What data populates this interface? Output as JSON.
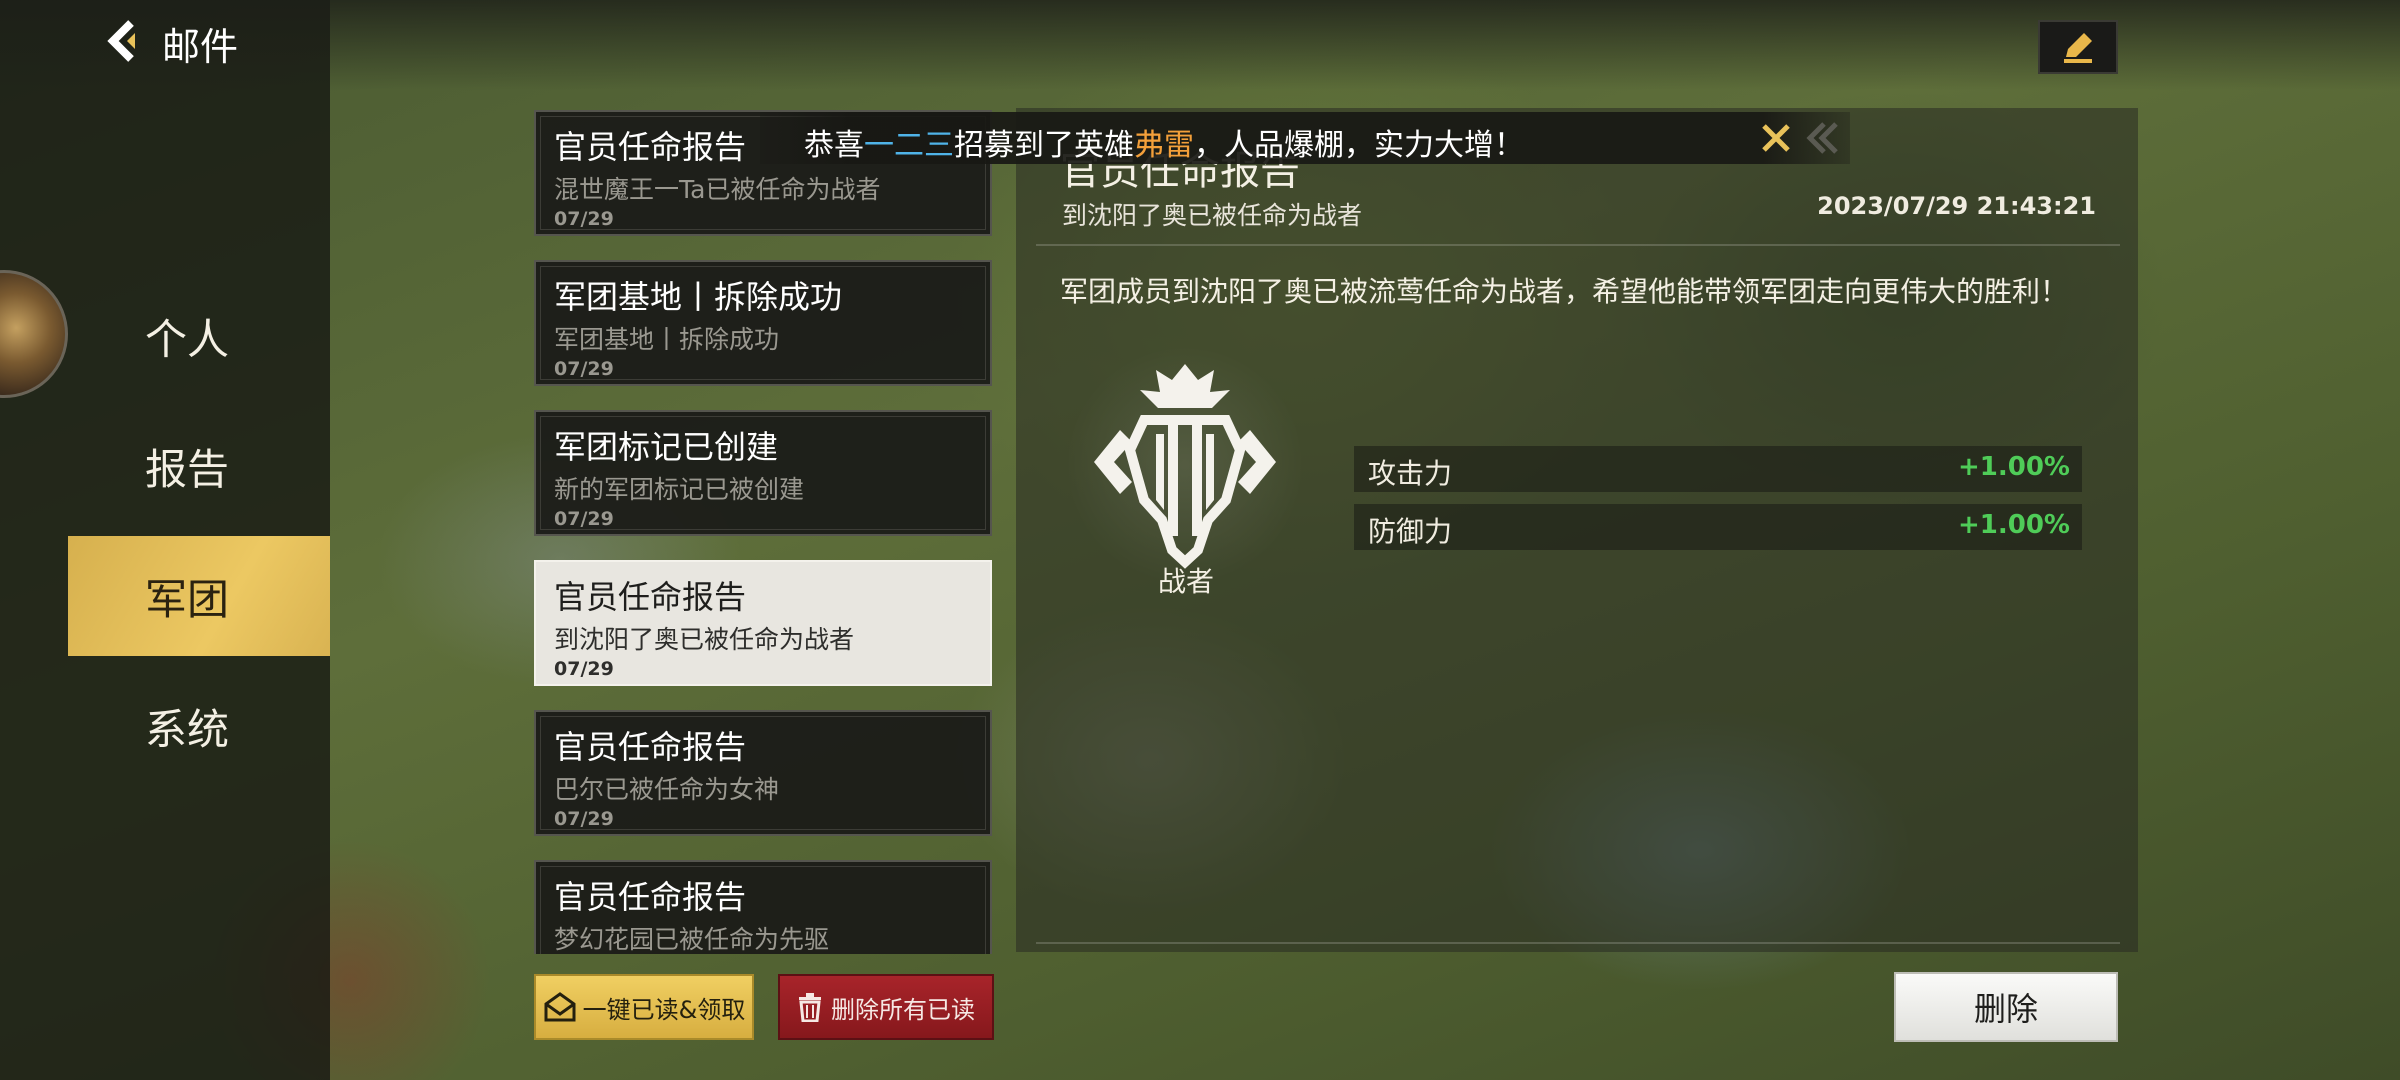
{
  "header": {
    "title": "邮件"
  },
  "sidebar": {
    "items": [
      {
        "label": "个人",
        "active": false
      },
      {
        "label": "报告",
        "active": false
      },
      {
        "label": "军团",
        "active": true
      },
      {
        "label": "系统",
        "active": false
      }
    ]
  },
  "mail_list": [
    {
      "title": "官员任命报告",
      "subtitle": "混世魔王一Ta已被任命为战者",
      "date": "07/29",
      "selected": false
    },
    {
      "title": "军团基地丨拆除成功",
      "subtitle": "军团基地丨拆除成功",
      "date": "07/29",
      "selected": false
    },
    {
      "title": "军团标记已创建",
      "subtitle": "新的军团标记已被创建",
      "date": "07/29",
      "selected": false
    },
    {
      "title": "官员任命报告",
      "subtitle": "到沈阳了奥已被任命为战者",
      "date": "07/29",
      "selected": true
    },
    {
      "title": "官员任命报告",
      "subtitle": "巴尔已被任命为女神",
      "date": "07/29",
      "selected": false
    },
    {
      "title": "官员任命报告",
      "subtitle": "梦幻花园已被任命为先驱",
      "date": "",
      "selected": false
    }
  ],
  "detail": {
    "title": "官员任命报告",
    "subtitle": "到沈阳了奥已被任命为战者",
    "timestamp": "2023/07/29 21:43:21",
    "body": "军团成员到沈阳了奥已被流莺任命为战者，希望他能带领军团走向更伟大的胜利！",
    "role": "战者",
    "stats": [
      {
        "name": "攻击力",
        "value": "+1.00%"
      },
      {
        "name": "防御力",
        "value": "+1.00%"
      }
    ]
  },
  "notification": {
    "prefix": "恭喜",
    "player": "一二三",
    "middle": "招募到了英雄",
    "hero": "弗雷",
    "suffix": "，人品爆棚，实力大增！"
  },
  "buttons": {
    "read_all": "一键已读&领取",
    "delete_all_read": "删除所有已读",
    "delete": "删除"
  },
  "colors": {
    "accent_gold": "#ecc862",
    "delete_red": "#a8242a",
    "stat_green": "#4fcc58",
    "player_blue": "#4fb3e8",
    "hero_orange": "#f4a03a"
  },
  "icons": [
    "back-arrow-icon",
    "edit-pencil-icon",
    "mail-icon",
    "trash-icon",
    "close-icon",
    "role-emblem-icon"
  ]
}
